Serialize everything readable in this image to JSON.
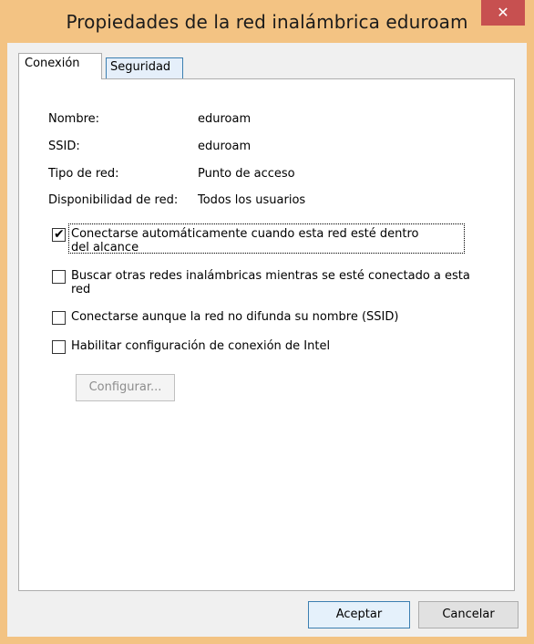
{
  "window": {
    "title": "Propiedades de la red inalámbrica eduroam",
    "close_glyph": "✕"
  },
  "tabs": [
    {
      "label": "Conexión",
      "selected": true
    },
    {
      "label": "Seguridad",
      "selected": false
    }
  ],
  "properties": [
    {
      "label": "Nombre:",
      "value": "eduroam"
    },
    {
      "label": "SSID:",
      "value": "eduroam"
    },
    {
      "label": "Tipo de red:",
      "value": "Punto de acceso"
    },
    {
      "label": "Disponibilidad de red:",
      "value": "Todos los usuarios"
    }
  ],
  "options": [
    {
      "line1": "Conectarse automáticamente cuando esta red esté dentro",
      "line2": "del alcance",
      "checked": true
    },
    {
      "line1": "Buscar otras redes inalámbricas mientras se esté conectado a esta",
      "line2": "red",
      "checked": false
    },
    {
      "line1": "Conectarse aunque la red no difunda su nombre (SSID)",
      "line2": "",
      "checked": false
    },
    {
      "line1": "Habilitar configuración de conexión de Intel",
      "line2": "",
      "checked": false
    }
  ],
  "buttons": {
    "configure": "Configurar...",
    "accept": "Aceptar",
    "cancel": "Cancelar"
  },
  "colors": {
    "title_bar": "#f3c383",
    "close_button": "#c75050",
    "dialog_bg": "#f0f0f0",
    "panel_bg": "#ffffff",
    "accent_border": "#3c7fb1"
  }
}
